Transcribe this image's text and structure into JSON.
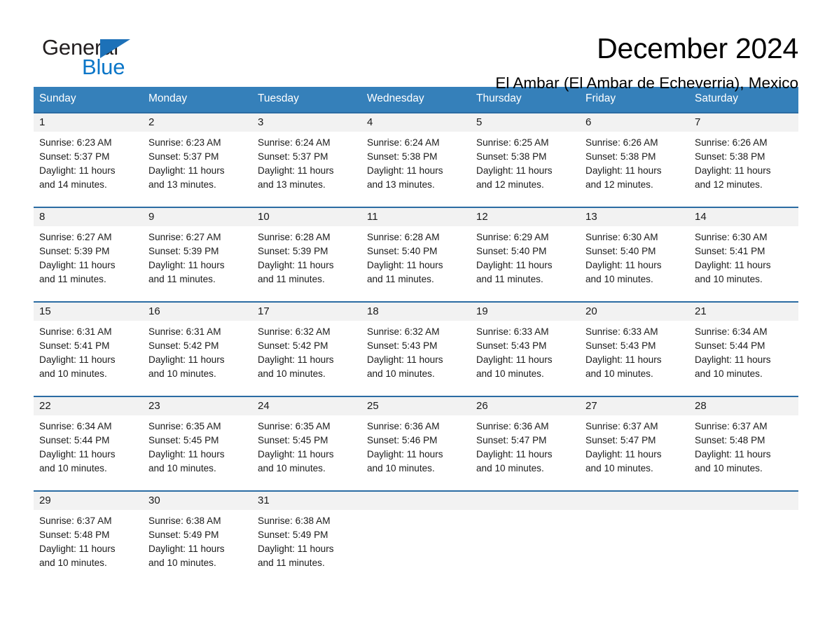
{
  "brand": {
    "logo_text_top": "General",
    "logo_text_bottom": "Blue",
    "logo_icon": "triangle-icon",
    "accent_blue": "#0b76c8",
    "header_blue": "#3580ba",
    "row_divider_blue": "#2b6ca3",
    "day_band_gray": "#f2f2f2"
  },
  "header": {
    "title": "December 2024",
    "subtitle": "El Ambar (El Ambar de Echeverria), Mexico"
  },
  "calendar": {
    "weekdays": [
      "Sunday",
      "Monday",
      "Tuesday",
      "Wednesday",
      "Thursday",
      "Friday",
      "Saturday"
    ],
    "weeks": [
      [
        {
          "day": "1",
          "sunrise": "Sunrise: 6:23 AM",
          "sunset": "Sunset: 5:37 PM",
          "daylight_line1": "Daylight: 11 hours",
          "daylight_line2": "and 14 minutes."
        },
        {
          "day": "2",
          "sunrise": "Sunrise: 6:23 AM",
          "sunset": "Sunset: 5:37 PM",
          "daylight_line1": "Daylight: 11 hours",
          "daylight_line2": "and 13 minutes."
        },
        {
          "day": "3",
          "sunrise": "Sunrise: 6:24 AM",
          "sunset": "Sunset: 5:37 PM",
          "daylight_line1": "Daylight: 11 hours",
          "daylight_line2": "and 13 minutes."
        },
        {
          "day": "4",
          "sunrise": "Sunrise: 6:24 AM",
          "sunset": "Sunset: 5:38 PM",
          "daylight_line1": "Daylight: 11 hours",
          "daylight_line2": "and 13 minutes."
        },
        {
          "day": "5",
          "sunrise": "Sunrise: 6:25 AM",
          "sunset": "Sunset: 5:38 PM",
          "daylight_line1": "Daylight: 11 hours",
          "daylight_line2": "and 12 minutes."
        },
        {
          "day": "6",
          "sunrise": "Sunrise: 6:26 AM",
          "sunset": "Sunset: 5:38 PM",
          "daylight_line1": "Daylight: 11 hours",
          "daylight_line2": "and 12 minutes."
        },
        {
          "day": "7",
          "sunrise": "Sunrise: 6:26 AM",
          "sunset": "Sunset: 5:38 PM",
          "daylight_line1": "Daylight: 11 hours",
          "daylight_line2": "and 12 minutes."
        }
      ],
      [
        {
          "day": "8",
          "sunrise": "Sunrise: 6:27 AM",
          "sunset": "Sunset: 5:39 PM",
          "daylight_line1": "Daylight: 11 hours",
          "daylight_line2": "and 11 minutes."
        },
        {
          "day": "9",
          "sunrise": "Sunrise: 6:27 AM",
          "sunset": "Sunset: 5:39 PM",
          "daylight_line1": "Daylight: 11 hours",
          "daylight_line2": "and 11 minutes."
        },
        {
          "day": "10",
          "sunrise": "Sunrise: 6:28 AM",
          "sunset": "Sunset: 5:39 PM",
          "daylight_line1": "Daylight: 11 hours",
          "daylight_line2": "and 11 minutes."
        },
        {
          "day": "11",
          "sunrise": "Sunrise: 6:28 AM",
          "sunset": "Sunset: 5:40 PM",
          "daylight_line1": "Daylight: 11 hours",
          "daylight_line2": "and 11 minutes."
        },
        {
          "day": "12",
          "sunrise": "Sunrise: 6:29 AM",
          "sunset": "Sunset: 5:40 PM",
          "daylight_line1": "Daylight: 11 hours",
          "daylight_line2": "and 11 minutes."
        },
        {
          "day": "13",
          "sunrise": "Sunrise: 6:30 AM",
          "sunset": "Sunset: 5:40 PM",
          "daylight_line1": "Daylight: 11 hours",
          "daylight_line2": "and 10 minutes."
        },
        {
          "day": "14",
          "sunrise": "Sunrise: 6:30 AM",
          "sunset": "Sunset: 5:41 PM",
          "daylight_line1": "Daylight: 11 hours",
          "daylight_line2": "and 10 minutes."
        }
      ],
      [
        {
          "day": "15",
          "sunrise": "Sunrise: 6:31 AM",
          "sunset": "Sunset: 5:41 PM",
          "daylight_line1": "Daylight: 11 hours",
          "daylight_line2": "and 10 minutes."
        },
        {
          "day": "16",
          "sunrise": "Sunrise: 6:31 AM",
          "sunset": "Sunset: 5:42 PM",
          "daylight_line1": "Daylight: 11 hours",
          "daylight_line2": "and 10 minutes."
        },
        {
          "day": "17",
          "sunrise": "Sunrise: 6:32 AM",
          "sunset": "Sunset: 5:42 PM",
          "daylight_line1": "Daylight: 11 hours",
          "daylight_line2": "and 10 minutes."
        },
        {
          "day": "18",
          "sunrise": "Sunrise: 6:32 AM",
          "sunset": "Sunset: 5:43 PM",
          "daylight_line1": "Daylight: 11 hours",
          "daylight_line2": "and 10 minutes."
        },
        {
          "day": "19",
          "sunrise": "Sunrise: 6:33 AM",
          "sunset": "Sunset: 5:43 PM",
          "daylight_line1": "Daylight: 11 hours",
          "daylight_line2": "and 10 minutes."
        },
        {
          "day": "20",
          "sunrise": "Sunrise: 6:33 AM",
          "sunset": "Sunset: 5:43 PM",
          "daylight_line1": "Daylight: 11 hours",
          "daylight_line2": "and 10 minutes."
        },
        {
          "day": "21",
          "sunrise": "Sunrise: 6:34 AM",
          "sunset": "Sunset: 5:44 PM",
          "daylight_line1": "Daylight: 11 hours",
          "daylight_line2": "and 10 minutes."
        }
      ],
      [
        {
          "day": "22",
          "sunrise": "Sunrise: 6:34 AM",
          "sunset": "Sunset: 5:44 PM",
          "daylight_line1": "Daylight: 11 hours",
          "daylight_line2": "and 10 minutes."
        },
        {
          "day": "23",
          "sunrise": "Sunrise: 6:35 AM",
          "sunset": "Sunset: 5:45 PM",
          "daylight_line1": "Daylight: 11 hours",
          "daylight_line2": "and 10 minutes."
        },
        {
          "day": "24",
          "sunrise": "Sunrise: 6:35 AM",
          "sunset": "Sunset: 5:45 PM",
          "daylight_line1": "Daylight: 11 hours",
          "daylight_line2": "and 10 minutes."
        },
        {
          "day": "25",
          "sunrise": "Sunrise: 6:36 AM",
          "sunset": "Sunset: 5:46 PM",
          "daylight_line1": "Daylight: 11 hours",
          "daylight_line2": "and 10 minutes."
        },
        {
          "day": "26",
          "sunrise": "Sunrise: 6:36 AM",
          "sunset": "Sunset: 5:47 PM",
          "daylight_line1": "Daylight: 11 hours",
          "daylight_line2": "and 10 minutes."
        },
        {
          "day": "27",
          "sunrise": "Sunrise: 6:37 AM",
          "sunset": "Sunset: 5:47 PM",
          "daylight_line1": "Daylight: 11 hours",
          "daylight_line2": "and 10 minutes."
        },
        {
          "day": "28",
          "sunrise": "Sunrise: 6:37 AM",
          "sunset": "Sunset: 5:48 PM",
          "daylight_line1": "Daylight: 11 hours",
          "daylight_line2": "and 10 minutes."
        }
      ],
      [
        {
          "day": "29",
          "sunrise": "Sunrise: 6:37 AM",
          "sunset": "Sunset: 5:48 PM",
          "daylight_line1": "Daylight: 11 hours",
          "daylight_line2": "and 10 minutes."
        },
        {
          "day": "30",
          "sunrise": "Sunrise: 6:38 AM",
          "sunset": "Sunset: 5:49 PM",
          "daylight_line1": "Daylight: 11 hours",
          "daylight_line2": "and 10 minutes."
        },
        {
          "day": "31",
          "sunrise": "Sunrise: 6:38 AM",
          "sunset": "Sunset: 5:49 PM",
          "daylight_line1": "Daylight: 11 hours",
          "daylight_line2": "and 11 minutes."
        },
        {
          "day": "",
          "sunrise": "",
          "sunset": "",
          "daylight_line1": "",
          "daylight_line2": ""
        },
        {
          "day": "",
          "sunrise": "",
          "sunset": "",
          "daylight_line1": "",
          "daylight_line2": ""
        },
        {
          "day": "",
          "sunrise": "",
          "sunset": "",
          "daylight_line1": "",
          "daylight_line2": ""
        },
        {
          "day": "",
          "sunrise": "",
          "sunset": "",
          "daylight_line1": "",
          "daylight_line2": ""
        }
      ]
    ]
  }
}
